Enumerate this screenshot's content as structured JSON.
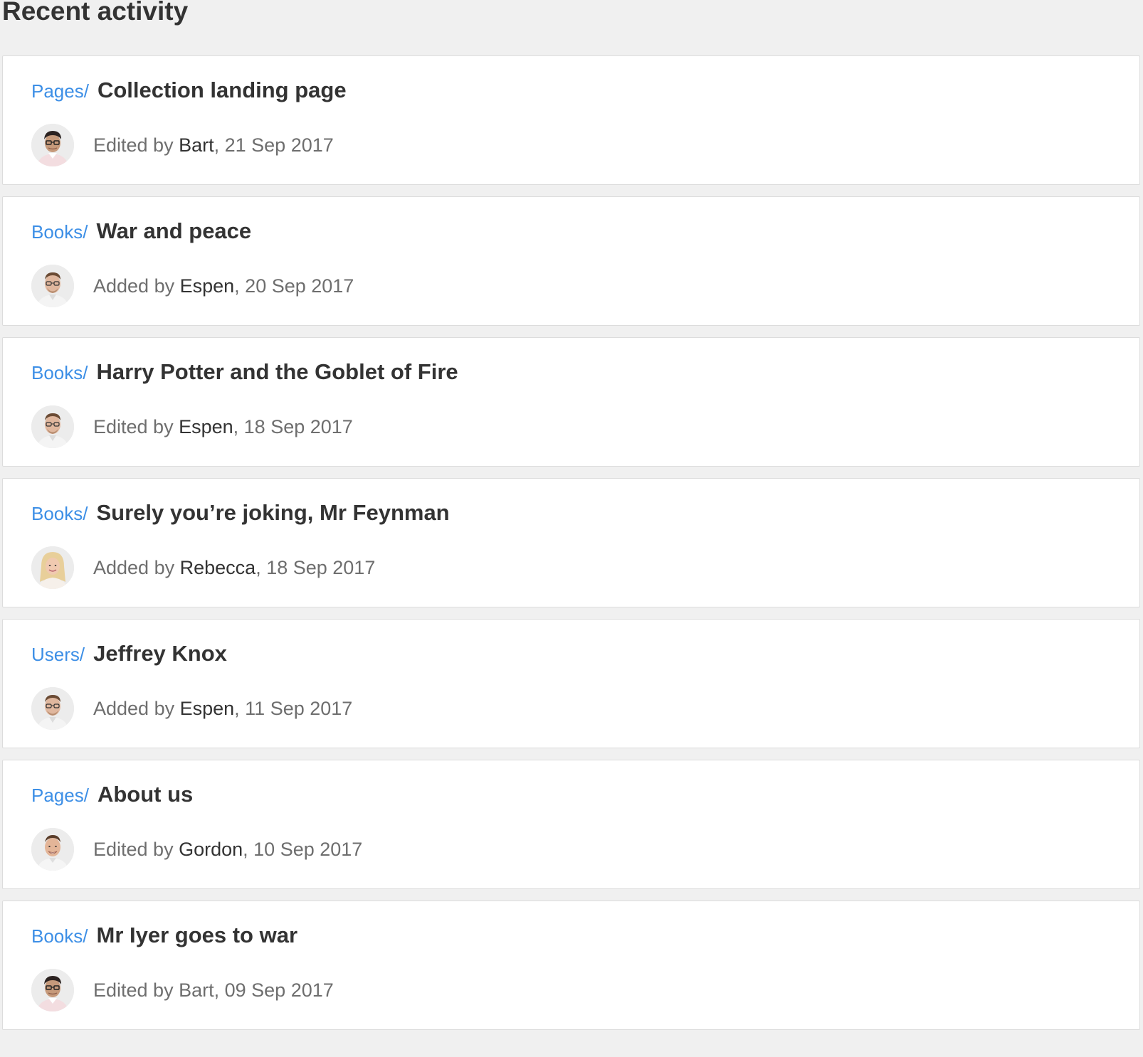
{
  "page": {
    "title": "Recent activity"
  },
  "colors": {
    "background": "#f0f0f0",
    "card": "#ffffff",
    "link": "#3d8fe6",
    "title": "#333333",
    "meta": "#6e6e6e"
  },
  "activities": [
    {
      "section": "Pages/",
      "title": "Collection landing page",
      "action": "Edited by",
      "user": "Bart",
      "date": ", 21 Sep 2017",
      "avatar_icon": "avatar-bart-icon"
    },
    {
      "section": "Books/",
      "title": "War and peace",
      "action": "Added by",
      "user": "Espen",
      "date": ", 20 Sep 2017",
      "avatar_icon": "avatar-espen-icon"
    },
    {
      "section": "Books/",
      "title": "Harry Potter and the Goblet of Fire",
      "action": "Edited by",
      "user": "Espen",
      "date": ", 18 Sep 2017",
      "avatar_icon": "avatar-espen-icon"
    },
    {
      "section": "Books/",
      "title": "Surely you’re joking, Mr Feynman",
      "action": "Added by",
      "user": "Rebecca",
      "date": ", 18 Sep 2017",
      "avatar_icon": "avatar-rebecca-icon"
    },
    {
      "section": "Users/",
      "title": "Jeffrey Knox",
      "action": "Added by",
      "user": "Espen",
      "date": ", 11 Sep 2017",
      "avatar_icon": "avatar-espen-icon"
    },
    {
      "section": "Pages/",
      "title": "About us",
      "action": "Edited by",
      "user": "Gordon",
      "date": ", 10 Sep 2017",
      "avatar_icon": "avatar-gordon-icon"
    },
    {
      "section": "Books/",
      "title": "Mr Iyer goes to war",
      "action": "Edited by",
      "user": "Bart",
      "date": ", 09 Sep 2017",
      "avatar_icon": "avatar-bart-icon"
    }
  ]
}
